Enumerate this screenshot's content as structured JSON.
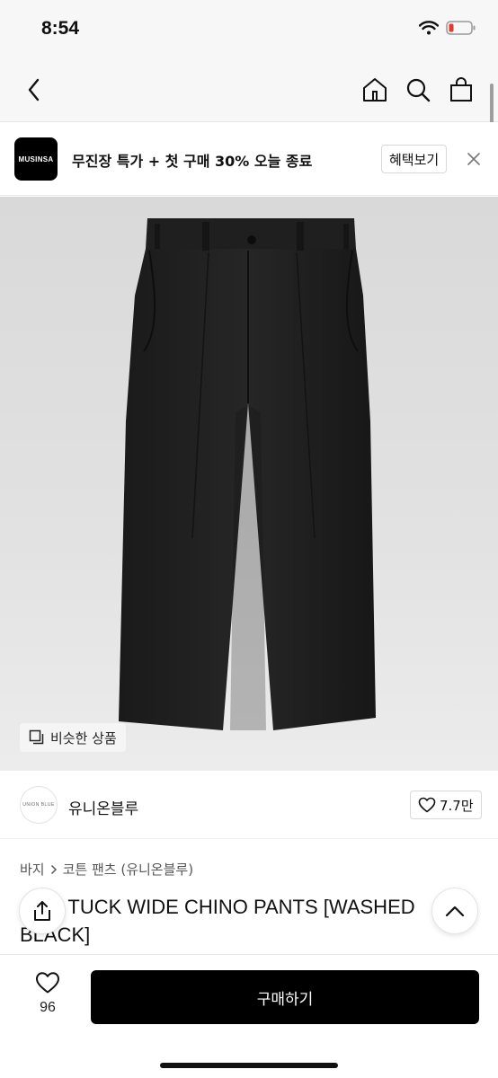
{
  "status_bar": {
    "time": "8:54"
  },
  "nav": {
    "icons": [
      "back-icon",
      "home-icon",
      "search-icon",
      "shopping-bag-icon"
    ]
  },
  "promo": {
    "logo_text": "MUSINSA",
    "text": "무진장 특가 + 첫 구매 30% 오늘 종료",
    "benefit_label": "혜택보기"
  },
  "product_image": {
    "similar_label": "비슷한 상품"
  },
  "brand": {
    "logo_text": "UNION BLUE",
    "name": "유니온블루",
    "likes": "7.7만"
  },
  "breadcrumb": {
    "level1": "바지",
    "level2": "코튼 팬츠 (유니온블루)"
  },
  "product": {
    "title": "ONE TUCK WIDE CHINO PANTS [WASHED BLACK]"
  },
  "bottom_bar": {
    "wish_count": "96",
    "buy_label": "구매하기"
  },
  "colors": {
    "accent": "#000000",
    "image_bg": "#dedede",
    "battery": "#e53935"
  }
}
